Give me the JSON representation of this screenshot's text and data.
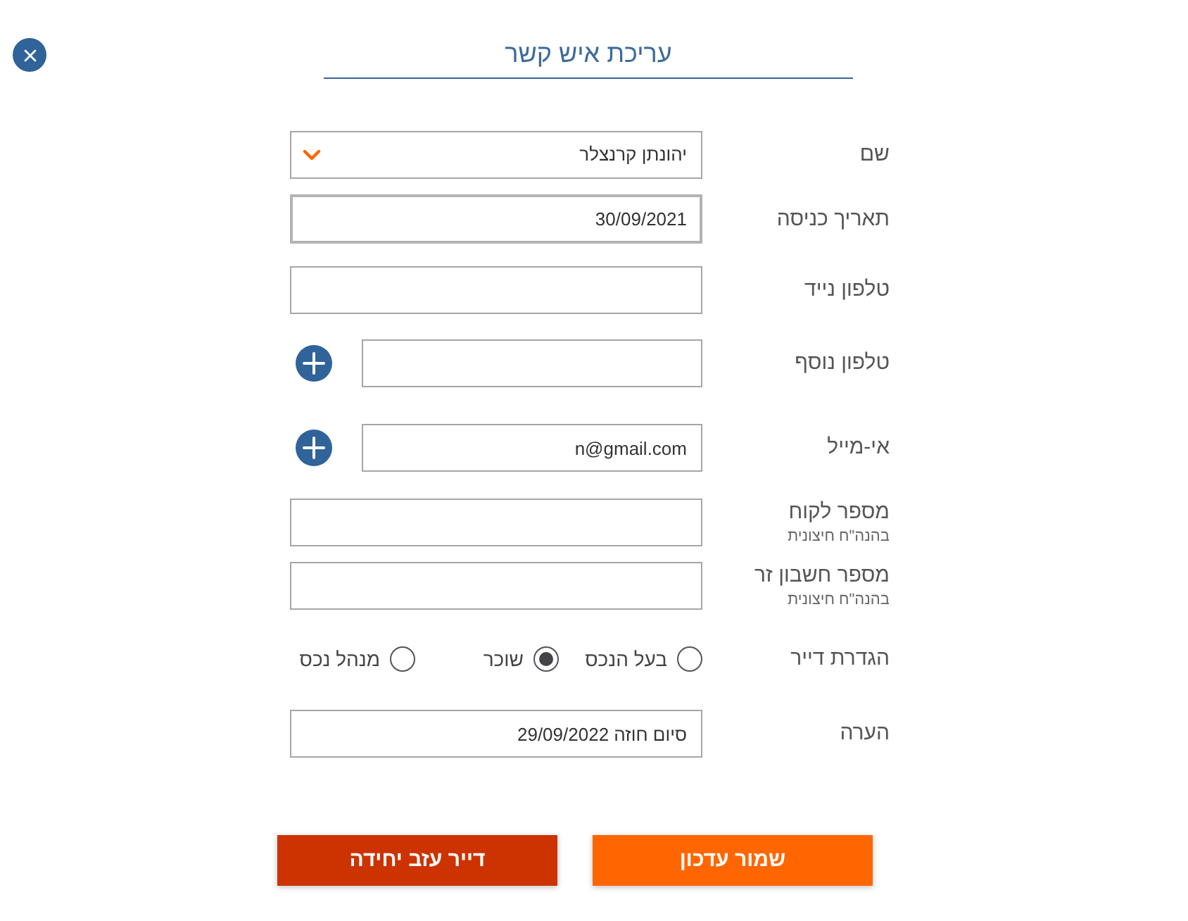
{
  "dialog": {
    "title": "עריכת איש קשר"
  },
  "fields": [
    {
      "kind": "select",
      "label": "שם",
      "value": "יהונתן קרנצלר"
    },
    {
      "kind": "date",
      "label": "תאריך כניסה",
      "value": "30/09/2021"
    },
    {
      "kind": "text",
      "label": "טלפון נייד",
      "add_button": false
    },
    {
      "kind": "text",
      "label": "טלפון נוסף",
      "add_button": true
    },
    {
      "kind": "text",
      "label": "אי-מייל",
      "value": "n@gmail.com",
      "add_button": true
    },
    {
      "kind": "text",
      "label": "מספר לקוח",
      "sublabel": "בהנה\"ח חיצונית",
      "add_button": false
    },
    {
      "kind": "text",
      "label": "מספר חשבון זר",
      "sublabel": "בהנה\"ח חיצונית",
      "add_button": false
    },
    {
      "kind": "radio",
      "label": "הגדרת דייר",
      "options": [
        {
          "label": "בעל הנכס",
          "selected": false
        },
        {
          "label": "שוכר",
          "selected": true
        },
        {
          "label": "מנהל נכס",
          "selected": false
        }
      ]
    },
    {
      "kind": "text",
      "label": "הערה",
      "value": "סיום חוזה 29/09/2022",
      "add_button": false
    }
  ],
  "buttons": [
    {
      "kind": "primary",
      "label": "שמור עדכון"
    },
    {
      "kind": "danger",
      "label": "דייר עזב יחידה"
    }
  ]
}
